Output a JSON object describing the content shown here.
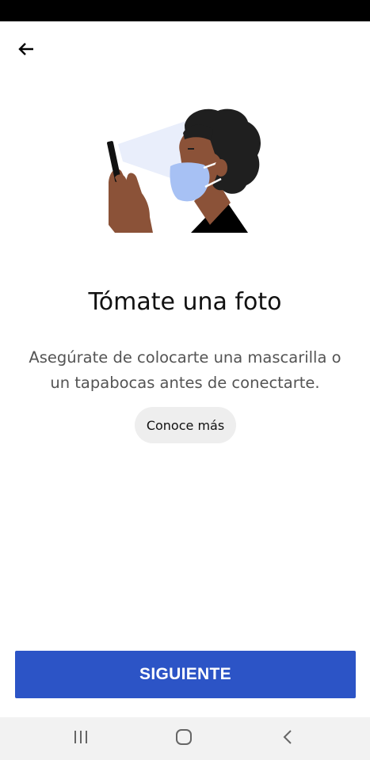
{
  "header": {
    "back_icon": "arrow-left-icon"
  },
  "illustration": {
    "icon": "person-masked-selfie-illustration",
    "colors": {
      "skin": "#8b5238",
      "hair": "#1f1f1f",
      "mask": "#a7c1f4",
      "cone": "#e9eefb",
      "shirt": "#000000"
    }
  },
  "main": {
    "title": "Tómate una foto",
    "description_line1": "Asegúrate de colocarte una mascarilla o",
    "description_line2": "un tapabocas antes de conectarte.",
    "learn_more_label": "Conoce más"
  },
  "footer": {
    "next_label": "SIGUIENTE",
    "accent_color": "#2c54c6"
  },
  "system_nav": {
    "recents_icon": "recents-icon",
    "home_icon": "home-icon",
    "back_icon": "chevron-left-icon"
  }
}
